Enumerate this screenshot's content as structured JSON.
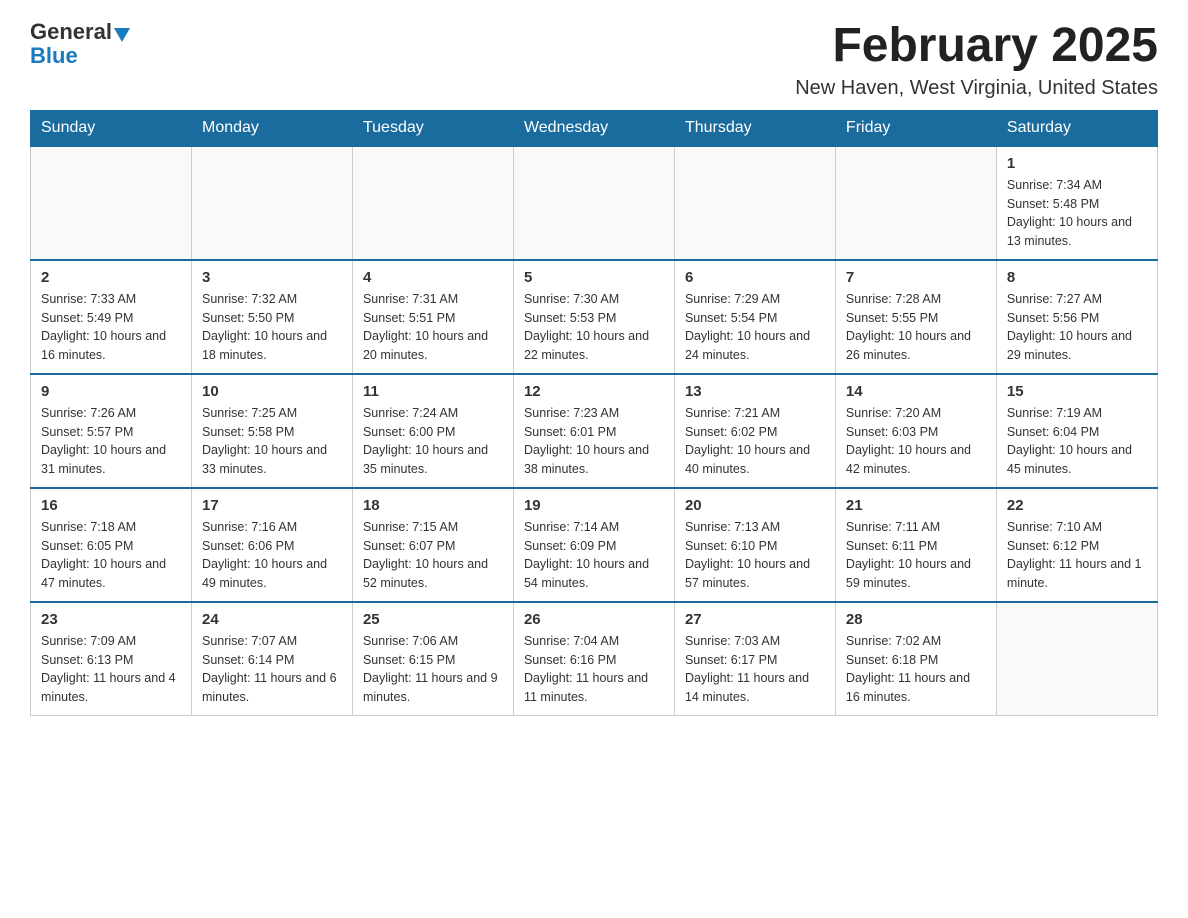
{
  "logo": {
    "general": "General",
    "blue": "Blue"
  },
  "title": "February 2025",
  "location": "New Haven, West Virginia, United States",
  "days_of_week": [
    "Sunday",
    "Monday",
    "Tuesday",
    "Wednesday",
    "Thursday",
    "Friday",
    "Saturday"
  ],
  "weeks": [
    [
      {
        "day": "",
        "info": ""
      },
      {
        "day": "",
        "info": ""
      },
      {
        "day": "",
        "info": ""
      },
      {
        "day": "",
        "info": ""
      },
      {
        "day": "",
        "info": ""
      },
      {
        "day": "",
        "info": ""
      },
      {
        "day": "1",
        "info": "Sunrise: 7:34 AM\nSunset: 5:48 PM\nDaylight: 10 hours and 13 minutes."
      }
    ],
    [
      {
        "day": "2",
        "info": "Sunrise: 7:33 AM\nSunset: 5:49 PM\nDaylight: 10 hours and 16 minutes."
      },
      {
        "day": "3",
        "info": "Sunrise: 7:32 AM\nSunset: 5:50 PM\nDaylight: 10 hours and 18 minutes."
      },
      {
        "day": "4",
        "info": "Sunrise: 7:31 AM\nSunset: 5:51 PM\nDaylight: 10 hours and 20 minutes."
      },
      {
        "day": "5",
        "info": "Sunrise: 7:30 AM\nSunset: 5:53 PM\nDaylight: 10 hours and 22 minutes."
      },
      {
        "day": "6",
        "info": "Sunrise: 7:29 AM\nSunset: 5:54 PM\nDaylight: 10 hours and 24 minutes."
      },
      {
        "day": "7",
        "info": "Sunrise: 7:28 AM\nSunset: 5:55 PM\nDaylight: 10 hours and 26 minutes."
      },
      {
        "day": "8",
        "info": "Sunrise: 7:27 AM\nSunset: 5:56 PM\nDaylight: 10 hours and 29 minutes."
      }
    ],
    [
      {
        "day": "9",
        "info": "Sunrise: 7:26 AM\nSunset: 5:57 PM\nDaylight: 10 hours and 31 minutes."
      },
      {
        "day": "10",
        "info": "Sunrise: 7:25 AM\nSunset: 5:58 PM\nDaylight: 10 hours and 33 minutes."
      },
      {
        "day": "11",
        "info": "Sunrise: 7:24 AM\nSunset: 6:00 PM\nDaylight: 10 hours and 35 minutes."
      },
      {
        "day": "12",
        "info": "Sunrise: 7:23 AM\nSunset: 6:01 PM\nDaylight: 10 hours and 38 minutes."
      },
      {
        "day": "13",
        "info": "Sunrise: 7:21 AM\nSunset: 6:02 PM\nDaylight: 10 hours and 40 minutes."
      },
      {
        "day": "14",
        "info": "Sunrise: 7:20 AM\nSunset: 6:03 PM\nDaylight: 10 hours and 42 minutes."
      },
      {
        "day": "15",
        "info": "Sunrise: 7:19 AM\nSunset: 6:04 PM\nDaylight: 10 hours and 45 minutes."
      }
    ],
    [
      {
        "day": "16",
        "info": "Sunrise: 7:18 AM\nSunset: 6:05 PM\nDaylight: 10 hours and 47 minutes."
      },
      {
        "day": "17",
        "info": "Sunrise: 7:16 AM\nSunset: 6:06 PM\nDaylight: 10 hours and 49 minutes."
      },
      {
        "day": "18",
        "info": "Sunrise: 7:15 AM\nSunset: 6:07 PM\nDaylight: 10 hours and 52 minutes."
      },
      {
        "day": "19",
        "info": "Sunrise: 7:14 AM\nSunset: 6:09 PM\nDaylight: 10 hours and 54 minutes."
      },
      {
        "day": "20",
        "info": "Sunrise: 7:13 AM\nSunset: 6:10 PM\nDaylight: 10 hours and 57 minutes."
      },
      {
        "day": "21",
        "info": "Sunrise: 7:11 AM\nSunset: 6:11 PM\nDaylight: 10 hours and 59 minutes."
      },
      {
        "day": "22",
        "info": "Sunrise: 7:10 AM\nSunset: 6:12 PM\nDaylight: 11 hours and 1 minute."
      }
    ],
    [
      {
        "day": "23",
        "info": "Sunrise: 7:09 AM\nSunset: 6:13 PM\nDaylight: 11 hours and 4 minutes."
      },
      {
        "day": "24",
        "info": "Sunrise: 7:07 AM\nSunset: 6:14 PM\nDaylight: 11 hours and 6 minutes."
      },
      {
        "day": "25",
        "info": "Sunrise: 7:06 AM\nSunset: 6:15 PM\nDaylight: 11 hours and 9 minutes."
      },
      {
        "day": "26",
        "info": "Sunrise: 7:04 AM\nSunset: 6:16 PM\nDaylight: 11 hours and 11 minutes."
      },
      {
        "day": "27",
        "info": "Sunrise: 7:03 AM\nSunset: 6:17 PM\nDaylight: 11 hours and 14 minutes."
      },
      {
        "day": "28",
        "info": "Sunrise: 7:02 AM\nSunset: 6:18 PM\nDaylight: 11 hours and 16 minutes."
      },
      {
        "day": "",
        "info": ""
      }
    ]
  ]
}
